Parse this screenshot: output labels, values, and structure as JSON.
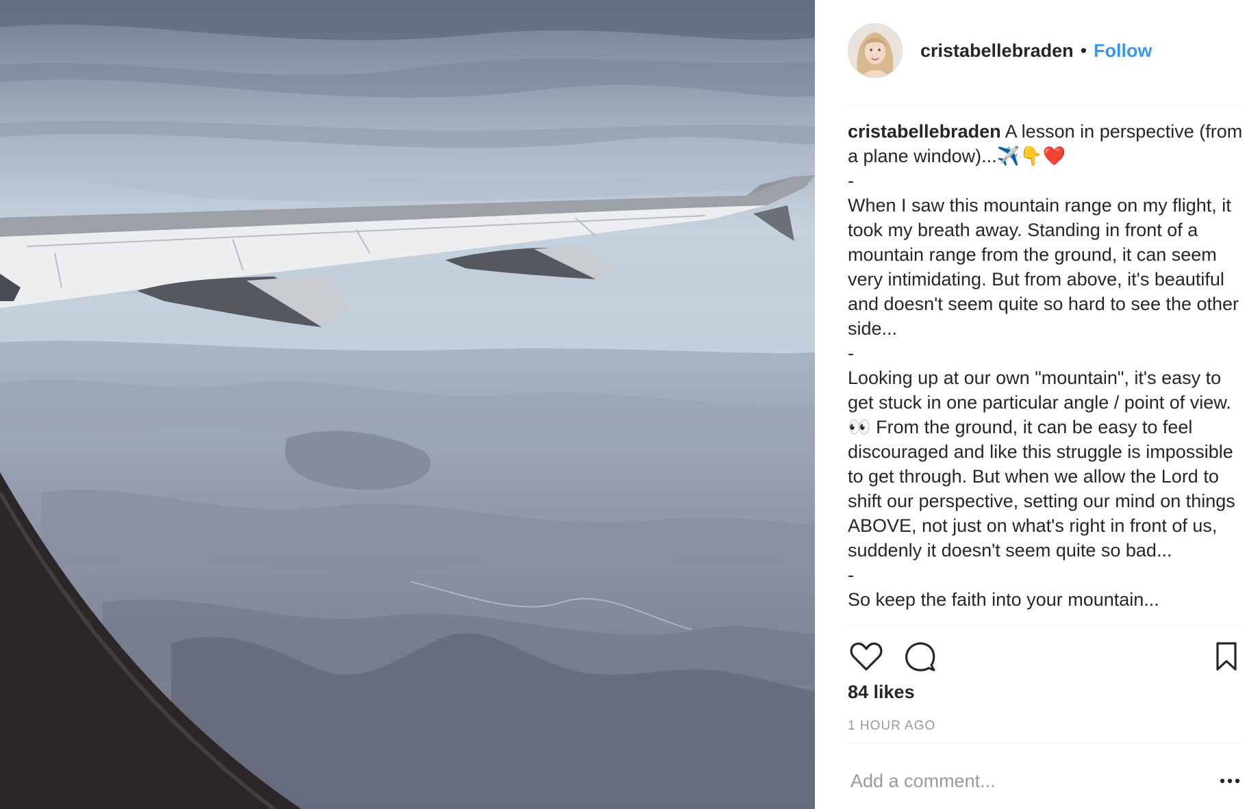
{
  "post": {
    "username": "cristabellebraden",
    "separator": "•",
    "follow_label": "Follow",
    "caption_username": "cristabellebraden",
    "caption_text": " A lesson in perspective (from a plane window)...✈️👇❤️\n-\nWhen I saw this mountain range on my flight, it took my breath away. Standing in front of a mountain range from the ground, it can seem very intimidating. But from above, it's beautiful and doesn't seem quite so hard to see the other side...\n-\nLooking up at our own \"mountain\", it's easy to get stuck in one particular angle / point of view. 👀 From the ground, it can be easy to feel discouraged and like this struggle is impossible to get through. But when we allow the Lord to shift our perspective, setting our mind on things ABOVE, not just on what's right in front of us, suddenly it doesn't seem quite so bad...\n-\nSo keep the faith into your mountain...",
    "likes": "84 likes",
    "timestamp": "1 HOUR AGO",
    "comment_placeholder": "Add a comment..."
  },
  "icons": {
    "like": "heart-icon",
    "comment": "comment-icon",
    "save": "bookmark-icon",
    "more": "more-options-icon"
  },
  "colors": {
    "link": "#3897f0",
    "text": "#262626",
    "muted": "#999999",
    "divider": "#efefef"
  }
}
